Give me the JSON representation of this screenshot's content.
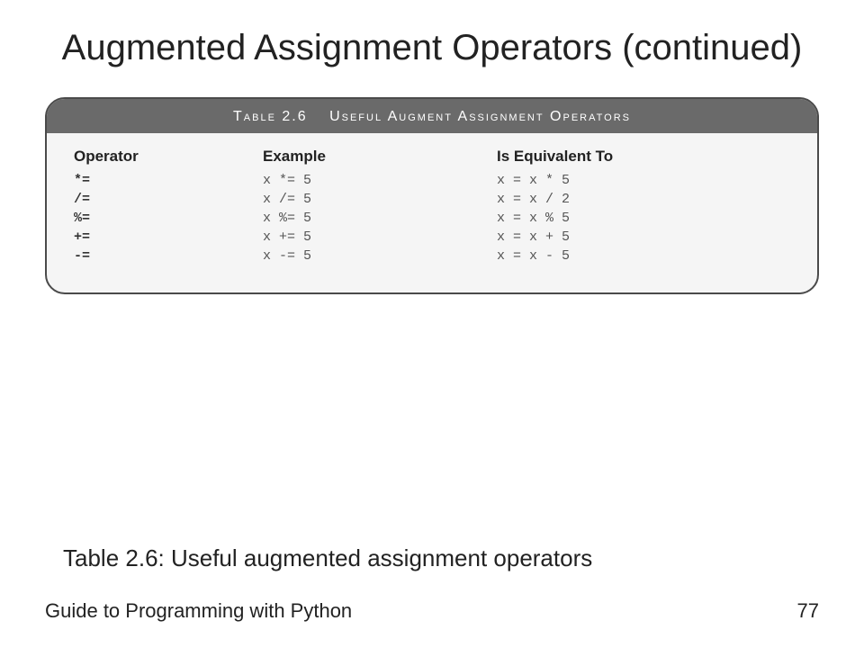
{
  "title": "Augmented Assignment Operators (continued)",
  "table": {
    "header_label": "Table 2.6",
    "header_caption": "Useful Augment Assignment Operators",
    "columns": {
      "c1": "Operator",
      "c2": "Example",
      "c3": "Is Equivalent To"
    },
    "rows": [
      {
        "op": "*=",
        "ex": "x *= 5",
        "eq": "x = x * 5"
      },
      {
        "op": "/=",
        "ex": "x /= 5",
        "eq": "x = x / 2"
      },
      {
        "op": "%=",
        "ex": "x %= 5",
        "eq": "x = x % 5"
      },
      {
        "op": "+=",
        "ex": "x += 5",
        "eq": "x = x + 5"
      },
      {
        "op": "-=",
        "ex": "x -= 5",
        "eq": "x = x - 5"
      }
    ]
  },
  "caption": "Table 2.6: Useful augmented assignment operators",
  "footer": {
    "left": "Guide to Programming with Python",
    "right": "77"
  }
}
